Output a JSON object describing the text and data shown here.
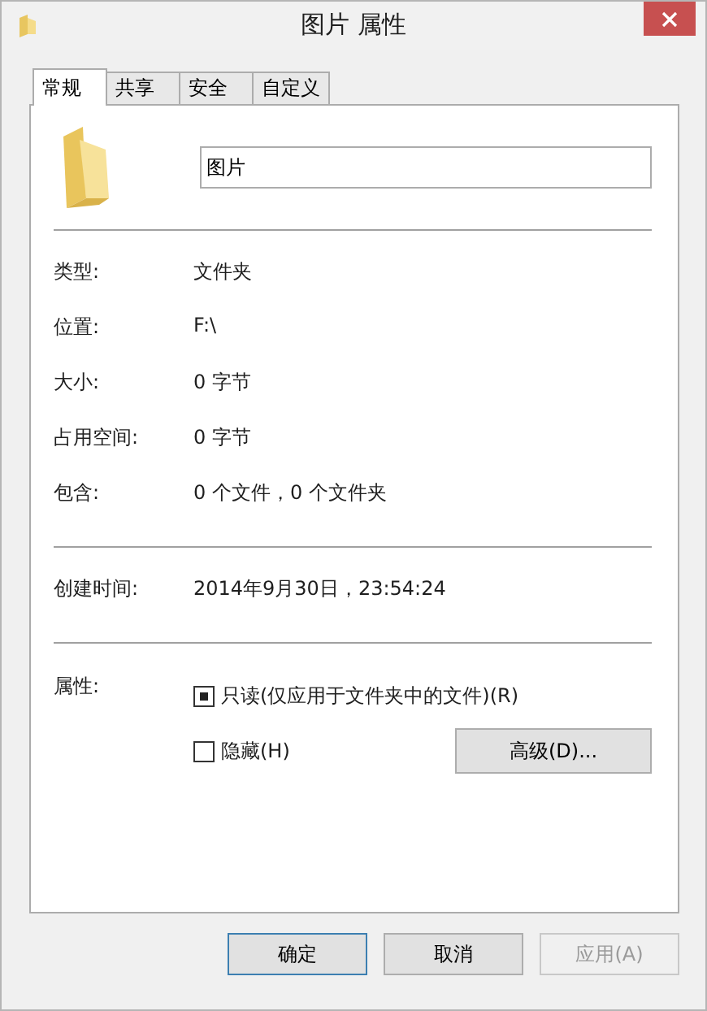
{
  "window": {
    "title": "图片 属性"
  },
  "tabs": [
    {
      "label": "常规",
      "selected": true
    },
    {
      "label": "共享",
      "selected": false
    },
    {
      "label": "安全",
      "selected": false
    },
    {
      "label": "自定义",
      "selected": false
    }
  ],
  "name_field": {
    "value": "图片"
  },
  "info_rows": [
    {
      "label": "类型:",
      "value": "文件夹"
    },
    {
      "label": "位置:",
      "value": "F:\\"
    },
    {
      "label": "大小:",
      "value": "0 字节"
    },
    {
      "label": "占用空间:",
      "value": "0 字节"
    },
    {
      "label": "包含:",
      "value": "0 个文件，0 个文件夹"
    }
  ],
  "created": {
    "label": "创建时间:",
    "value": "2014年9月30日，23:54:24"
  },
  "attributes": {
    "label": "属性:",
    "checkboxes": [
      {
        "label": "只读(仅应用于文件夹中的文件)(R)",
        "indeterminate": true
      },
      {
        "label": "隐藏(H)",
        "indeterminate": false
      }
    ],
    "advanced_button": "高级(D)..."
  },
  "buttons": [
    {
      "label": "确定",
      "disabled": false
    },
    {
      "label": "取消",
      "disabled": false
    },
    {
      "label": "应用(A)",
      "disabled": true
    }
  ]
}
